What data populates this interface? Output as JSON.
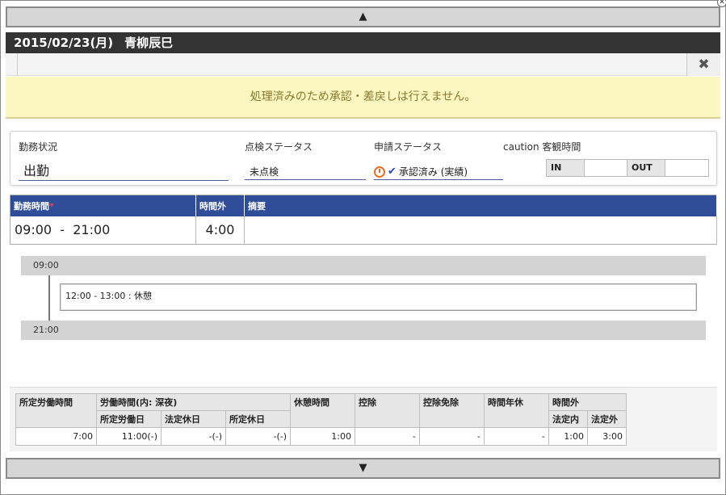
{
  "scroll": {
    "up_glyph": "▲",
    "down_glyph": "▼"
  },
  "header": {
    "date": "2015/02/23(月)",
    "name": "青柳辰巳"
  },
  "close_glyph": "✖",
  "corner_glyph": "✕",
  "notice": "処理済みのため承認・差戻しは行えません。",
  "status": {
    "work_label": "勤務状況",
    "work_value": "出勤",
    "check_label": "点検ステータス",
    "check_value": "未点検",
    "app_label": "申請ステータス",
    "app_value": "承認済み (実績)",
    "obj_label": "caution 客観時間",
    "in_label": "IN",
    "in_value": "",
    "out_label": "OUT",
    "out_value": ""
  },
  "work_table": {
    "col_time": "勤務時間",
    "required_mark": "*",
    "col_overtime": "時間外",
    "col_note": "摘要",
    "time_value": "09:00  -  21:00",
    "overtime_value": "4:00",
    "note_value": ""
  },
  "timeline": {
    "start": "09:00",
    "end": "21:00",
    "block": "12:00 - 13:00 : 休憩"
  },
  "summary": {
    "h_scheduled": "所定労働時間",
    "h_worked": "労働時間(内: 深夜)",
    "h_sched_day": "所定労働日",
    "h_legal_holiday": "法定休日",
    "h_sched_holiday": "所定休日",
    "h_break": "休憩時間",
    "h_deduct": "控除",
    "h_deduct_exempt": "控除免除",
    "h_hourly_leave": "時間年休",
    "h_overtime": "時間外",
    "h_ot_in": "法定内",
    "h_ot_out": "法定外",
    "v_scheduled": "7:00",
    "v_sched_day": "11:00(-)",
    "v_legal_holiday": "-(-)",
    "v_sched_holiday": "-(-)",
    "v_break": "1:00",
    "v_deduct": "-",
    "v_deduct_exempt": "-",
    "v_hourly_leave": "-",
    "v_ot_in": "1:00",
    "v_ot_out": "3:00"
  },
  "colors": {
    "title_bg": "#333333",
    "table_header": "#2f4d98",
    "notice_bg": "#fbf6c2",
    "notice_text": "#8b7a2a"
  }
}
